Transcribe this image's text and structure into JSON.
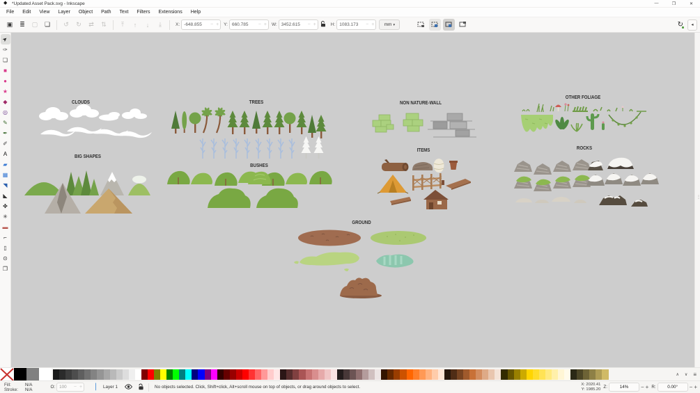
{
  "window": {
    "title": "*Updated Asset Pack.svg - Inkscape",
    "controls": {
      "minimize": "—",
      "maximize": "❐",
      "close": "✕"
    }
  },
  "menu": {
    "items": [
      "File",
      "Edit",
      "View",
      "Layer",
      "Object",
      "Path",
      "Text",
      "Filters",
      "Extensions",
      "Help"
    ]
  },
  "toolbar": {
    "command_icons": [
      {
        "name": "select-all",
        "glyph": "▣",
        "enabled": true
      },
      {
        "name": "select-same",
        "glyph": "≣",
        "enabled": true
      },
      {
        "name": "deselect",
        "glyph": "▢",
        "enabled": false
      },
      {
        "name": "selection-box",
        "glyph": "❏",
        "enabled": true
      },
      {
        "name": "rotate-ccw",
        "glyph": "↺",
        "enabled": false
      },
      {
        "name": "rotate-cw",
        "glyph": "↻",
        "enabled": false
      },
      {
        "name": "flip-horizontal",
        "glyph": "⇄",
        "enabled": false
      },
      {
        "name": "flip-vertical",
        "glyph": "⇅",
        "enabled": false
      },
      {
        "name": "raise-to-top",
        "glyph": "⤒",
        "enabled": false
      },
      {
        "name": "raise",
        "glyph": "↑",
        "enabled": false
      },
      {
        "name": "lower",
        "glyph": "↓",
        "enabled": false
      },
      {
        "name": "lower-to-bottom",
        "glyph": "⤓",
        "enabled": false
      }
    ],
    "x_label": "X:",
    "x_value": "-648.855",
    "y_label": "Y:",
    "y_value": "660.785",
    "w_label": "W:",
    "w_value": "3452.615",
    "h_label": "H:",
    "h_value": "1083.173",
    "unit": "mm",
    "unit_arrow": "▾",
    "stepper_minus": "−",
    "stepper_plus": "+",
    "collapse_arrow": "◂"
  },
  "toolbox": {
    "tools": [
      {
        "name": "selector-tool",
        "glyph": "➤",
        "color": "#222222",
        "active": true,
        "rotate": true
      },
      {
        "name": "node-tool",
        "glyph": "✑",
        "color": "#444444"
      },
      {
        "name": "shape-builder-tool",
        "glyph": "❏",
        "color": "#444444"
      },
      {
        "name": "rectangle-tool",
        "glyph": "■",
        "color": "#d93a8c"
      },
      {
        "name": "ellipse-tool",
        "glyph": "●",
        "color": "#d93a8c"
      },
      {
        "name": "star-tool",
        "glyph": "★",
        "color": "#d93a8c"
      },
      {
        "name": "box-3d-tool",
        "glyph": "◆",
        "color": "#a02a68"
      },
      {
        "name": "spiral-tool",
        "glyph": "◎",
        "color": "#6d3a8c"
      },
      {
        "name": "pencil-tool",
        "glyph": "✎",
        "color": "#3d6b2f"
      },
      {
        "name": "pen-tool",
        "glyph": "✒",
        "color": "#3d6b2f"
      },
      {
        "name": "calligraphy-tool",
        "glyph": "✐",
        "color": "#444444"
      },
      {
        "name": "text-tool",
        "glyph": "A",
        "color": "#111111"
      },
      {
        "name": "gradient-tool",
        "glyph": "▰",
        "color": "#3b7bd4"
      },
      {
        "name": "mesh-gradient-tool",
        "glyph": "▦",
        "color": "#3b7bd4"
      },
      {
        "name": "dropper-tool",
        "glyph": "◥",
        "color": "#2b5fae"
      },
      {
        "name": "paint-bucket-tool",
        "glyph": "◣",
        "color": "#333333"
      },
      {
        "name": "tweak-tool",
        "glyph": "✤",
        "color": "#333333"
      },
      {
        "name": "spray-tool",
        "glyph": "✳",
        "color": "#333333"
      },
      {
        "name": "eraser-tool",
        "glyph": "▬",
        "color": "#b8564e"
      },
      {
        "name": "connector-tool",
        "glyph": "⌐",
        "color": "#333333"
      },
      {
        "name": "page-tool",
        "glyph": "▯",
        "color": "#333333"
      },
      {
        "name": "zoom-tool",
        "glyph": "⊙",
        "color": "#333333"
      },
      {
        "name": "measure-tool",
        "glyph": "❐",
        "color": "#333333"
      }
    ]
  },
  "canvas": {
    "sections": {
      "clouds": {
        "label": "CLOUDS"
      },
      "big_shapes": {
        "label": "BIG SHAPES"
      },
      "trees": {
        "label": "TREES"
      },
      "bushes": {
        "label": "BUSHES"
      },
      "non_nature_wall": {
        "label": "NON NATURE-WALL"
      },
      "items": {
        "label": "ITEMS"
      },
      "other_foliage": {
        "label": "OTHER FOLIAGE"
      },
      "rocks": {
        "label": "ROCKS"
      },
      "ground": {
        "label": "GROUND"
      }
    },
    "background": "#cdcdcd"
  },
  "palette": {
    "specials": [
      {
        "name": "no-color",
        "type": "none"
      },
      {
        "name": "black",
        "hex": "#000000"
      },
      {
        "name": "gray",
        "hex": "#808080"
      },
      {
        "name": "white",
        "hex": "#ffffff"
      }
    ],
    "colors": [
      "#1a1a1a",
      "#2b2b2b",
      "#3d3d3d",
      "#4d4d4d",
      "#5f5f5f",
      "#717171",
      "#838383",
      "#959595",
      "#a7a7a7",
      "#b9b9b9",
      "#cbcbcb",
      "#dddddd",
      "#efefef",
      "#ffffff",
      "#800000",
      "#ff0000",
      "#808000",
      "#ffff00",
      "#008000",
      "#00ff00",
      "#008080",
      "#00ffff",
      "#000080",
      "#0000ff",
      "#800080",
      "#ff00ff",
      "#330000",
      "#660000",
      "#990000",
      "#cc0000",
      "#ff0000",
      "#ff3333",
      "#ff6666",
      "#ff9999",
      "#ffcccc",
      "#ffe6e6",
      "#2b1616",
      "#562d2d",
      "#804040",
      "#aa5555",
      "#c87373",
      "#d98e8e",
      "#e6aaaa",
      "#f0c6c6",
      "#f9e2e2",
      "#241c1c",
      "#483838",
      "#6c5454",
      "#907070",
      "#b49c9c",
      "#d0c0c0",
      "#ece4e4",
      "#331400",
      "#662900",
      "#993d00",
      "#cc5200",
      "#ff6600",
      "#ff7f2a",
      "#ff9955",
      "#ffb380",
      "#ffccaa",
      "#ffe6d5",
      "#28170b",
      "#502d16",
      "#784421",
      "#a05a2c",
      "#c87137",
      "#d38d5f",
      "#deaa87",
      "#e9c6af",
      "#f4e3d7",
      "#332b00",
      "#665500",
      "#998000",
      "#ccaa00",
      "#ffd500",
      "#ffdd2a",
      "#ffe355",
      "#ffea80",
      "#fff0aa",
      "#fff6d5",
      "#fffbea",
      "#2b2916",
      "#4c4626",
      "#6d6336",
      "#8e8046",
      "#af9d56",
      "#d0ba66"
    ],
    "up_arrow": "∧",
    "down_arrow": "∨",
    "menu_icon": "≡"
  },
  "statusbar": {
    "fill_label": "Fill:",
    "fill_value": "N/A",
    "stroke_label": "Stroke:",
    "stroke_value": "N/A",
    "opacity_label": "O:",
    "opacity_value": "100",
    "layer_label": "Layer 1",
    "message": "No objects selected. Click, Shift+click, Alt+scroll mouse on top of objects, or drag around objects to select.",
    "x_label": "X:",
    "x_value": "2020.41",
    "y_label": "Y:",
    "y_value": "1985.20",
    "zoom_label": "Z:",
    "zoom_value": "14%",
    "rotation_label": "R:",
    "rotation_value": "0.00°",
    "stepper_minus": "−",
    "stepper_plus": "+"
  }
}
